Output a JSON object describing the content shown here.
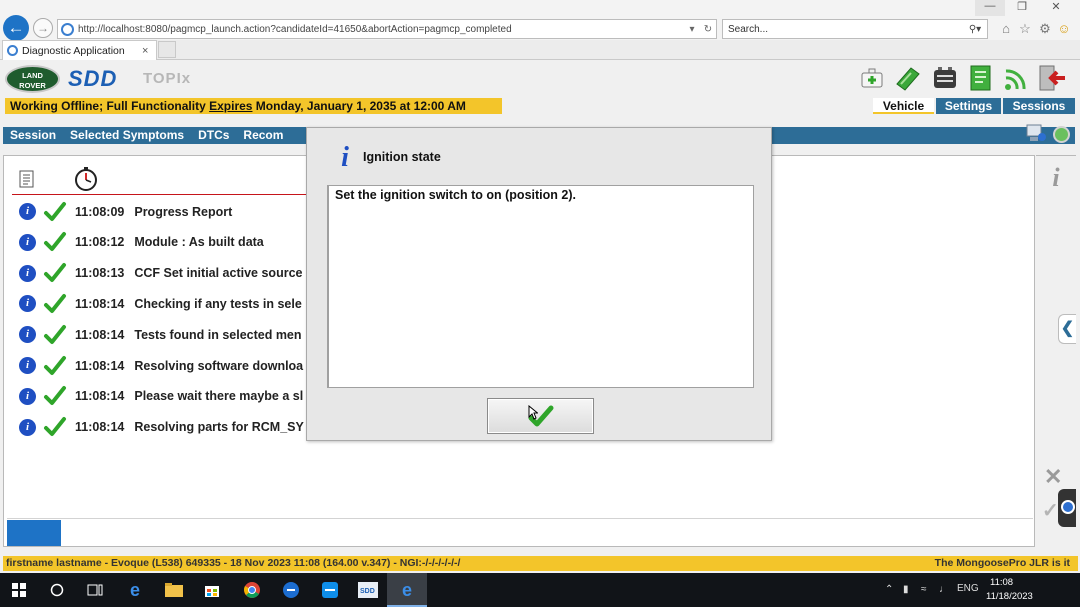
{
  "browser": {
    "url": "http://localhost:8080/pagmcp_launch.action?candidateId=41650&abortAction=pagmcp_completed",
    "search_placeholder": "Search...",
    "tab_title": "Diagnostic Application",
    "tab_close": "×"
  },
  "app": {
    "logo_brand": "LAND ROVER",
    "logo_sdd": "SDD",
    "logo_topix": "TOPIx"
  },
  "status": {
    "banner_prefix": "Working Offline; Full Functionality ",
    "banner_expires": "Expires",
    "banner_suffix": " Monday, January 1, 2035 at 12:00 AM",
    "tabs": [
      "Vehicle",
      "Settings",
      "Sessions"
    ]
  },
  "menu": {
    "items": [
      "Session",
      "Selected Symptoms",
      "DTCs",
      "Recom"
    ]
  },
  "log": {
    "rows": [
      {
        "time": "11:08:09",
        "message": "Progress Report"
      },
      {
        "time": "11:08:12",
        "message": "Module : As built data"
      },
      {
        "time": "11:08:13",
        "message": "CCF Set initial active source"
      },
      {
        "time": "11:08:14",
        "message": "Checking if any tests in sele"
      },
      {
        "time": "11:08:14",
        "message": "Tests found in selected men"
      },
      {
        "time": "11:08:14",
        "message": "Resolving software downloa"
      },
      {
        "time": "11:08:14",
        "message": "Please wait there maybe a sl"
      },
      {
        "time": "11:08:14",
        "message": "Resolving parts for RCM_SY"
      }
    ]
  },
  "dialog": {
    "title": "Ignition state",
    "message": "Set the ignition switch to on (position 2)."
  },
  "footer": {
    "left": "firstname lastname - Evoque (L538) 649335 - 18 Nov 2023 11:08 (164.00 v.347) - NGI:-/-/-/-/-/-/",
    "right": "The MongoosePro JLR is it"
  },
  "taskbar": {
    "lang": "ENG",
    "time": "11:08",
    "date": "11/18/2023"
  },
  "colors": {
    "accent_blue": "#2d6d97",
    "banner_yellow": "#f3c52a",
    "check_green": "#2fa52a",
    "info_blue": "#1f4fc2"
  }
}
